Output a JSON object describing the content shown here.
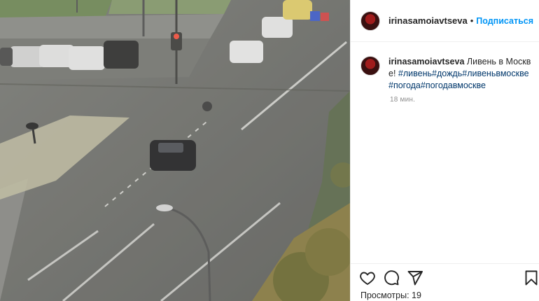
{
  "header": {
    "username": "irinasamoiavtseva",
    "separator": "•",
    "follow_label": "Подписаться"
  },
  "caption": {
    "username": "irinasamoiavtseva",
    "text": "Ливень в Москве!",
    "hashtags": "#ливень#дождь#ливеньвмоскве#погода#погодавмоскве",
    "time": "18 мин."
  },
  "actions": {
    "icons": [
      "heart-icon",
      "comment-icon",
      "share-icon",
      "bookmark-icon"
    ],
    "views_label": "Просмотры:",
    "views_count": "19"
  },
  "colors": {
    "accent": "#0095f6",
    "hashtag": "#00376b",
    "muted": "#8e8e8e",
    "text": "#262626"
  }
}
